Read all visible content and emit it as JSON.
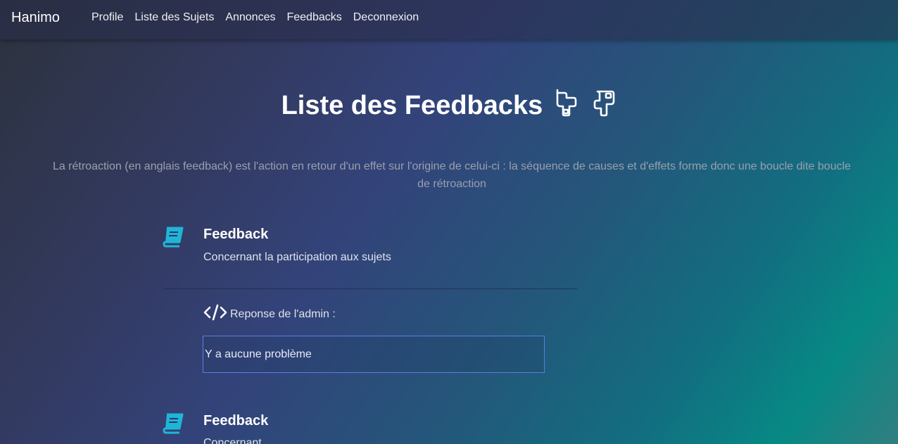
{
  "navbar": {
    "brand": "Hanimo",
    "links": [
      "Profile",
      "Liste des Sujets",
      "Annonces",
      "Feedbacks",
      "Deconnexion"
    ]
  },
  "page": {
    "title": "Liste des Feedbacks",
    "title_icons": [
      "pointing-up-hand-icon",
      "pointing-down-hand-icon"
    ],
    "intro": "La rétroaction (en anglais feedback) est l'action en retour d'un effet sur l'origine de celui-ci : la séquence de causes et d'effets forme donc une boucle dite boucle de rétroaction"
  },
  "feedbacks": [
    {
      "icon": "book-icon",
      "title": "Feedback",
      "subject": "Concernant la participation aux sujets",
      "reply_icon": "code-icon",
      "reply_label": "Reponse de l'admin :",
      "reply_value": "Y a aucune problème"
    },
    {
      "icon": "book-icon",
      "title": "Feedback",
      "subject": "Concernant"
    }
  ],
  "colors": {
    "accent": "#1fb6d6",
    "input_border": "#5b7de6"
  }
}
